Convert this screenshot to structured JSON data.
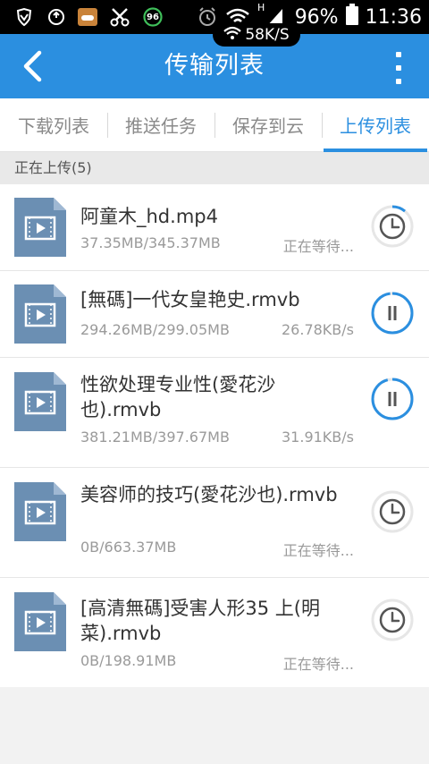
{
  "status_bar": {
    "battery": "96%",
    "time": "11:36",
    "network_speed": "58K/S",
    "app_badge": "96",
    "signal_type": "H"
  },
  "title_bar": {
    "title": "传输列表"
  },
  "tabs": [
    {
      "label": "下载列表",
      "active": false
    },
    {
      "label": "推送任务",
      "active": false
    },
    {
      "label": "保存到云",
      "active": false
    },
    {
      "label": "上传列表",
      "active": true
    }
  ],
  "section": {
    "label": "正在上传(5)"
  },
  "items": [
    {
      "name": "阿童木_hd.mp4",
      "size": "37.35MB/345.37MB",
      "status": "正在等待...",
      "action": "waiting",
      "progress": 0.11
    },
    {
      "name": "[無碼]一代女皇艳史.rmvb",
      "size": "294.26MB/299.05MB",
      "status": "26.78KB/s",
      "action": "pause",
      "progress": 0.98
    },
    {
      "name": "性欲处理专业性(愛花沙也).rmvb",
      "size": "381.21MB/397.67MB",
      "status": "31.91KB/s",
      "action": "pause",
      "progress": 0.96
    },
    {
      "name": "美容师的技巧(愛花沙也).rmvb",
      "size": "0B/663.37MB",
      "status": "正在等待...",
      "action": "waiting",
      "progress": 0
    },
    {
      "name": "[高清無碼]受害人形35 上(明菜).rmvb",
      "size": "0B/198.91MB",
      "status": "正在等待...",
      "action": "waiting",
      "progress": 0
    }
  ],
  "colors": {
    "accent": "#2b8fe0",
    "file_icon": "#6b8fb3",
    "ring_track": "#e6e6e6",
    "icon_gray": "#555555"
  }
}
